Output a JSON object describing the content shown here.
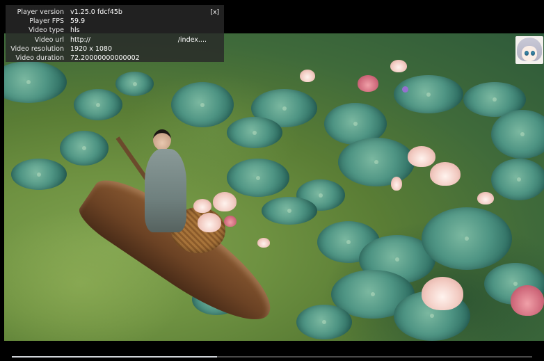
{
  "player": {
    "info_panel": {
      "close_label": "[x]",
      "rows": [
        {
          "key": "Player version",
          "value": "v1.25.0 fdcf45b"
        },
        {
          "key": "Player FPS",
          "value": "59.9"
        },
        {
          "key": "Video type",
          "value": "hls"
        },
        {
          "key": "Video url",
          "value_start": "http://",
          "value_end": "/index...."
        },
        {
          "key": "Video resolution",
          "value": "1920 x 1080"
        },
        {
          "key": "Video duration",
          "value": "72.20000000000002"
        }
      ]
    },
    "progress": {
      "played_fraction": 0.395,
      "fill_color": "#cfd3d8",
      "track_color": "#4a4a4a"
    },
    "icons": {
      "avatar": "anime-avatar-icon",
      "close": "close-icon"
    },
    "colors": {
      "background": "#000000",
      "panel": "#282828",
      "accent_dot": "#9d6bd8"
    }
  }
}
